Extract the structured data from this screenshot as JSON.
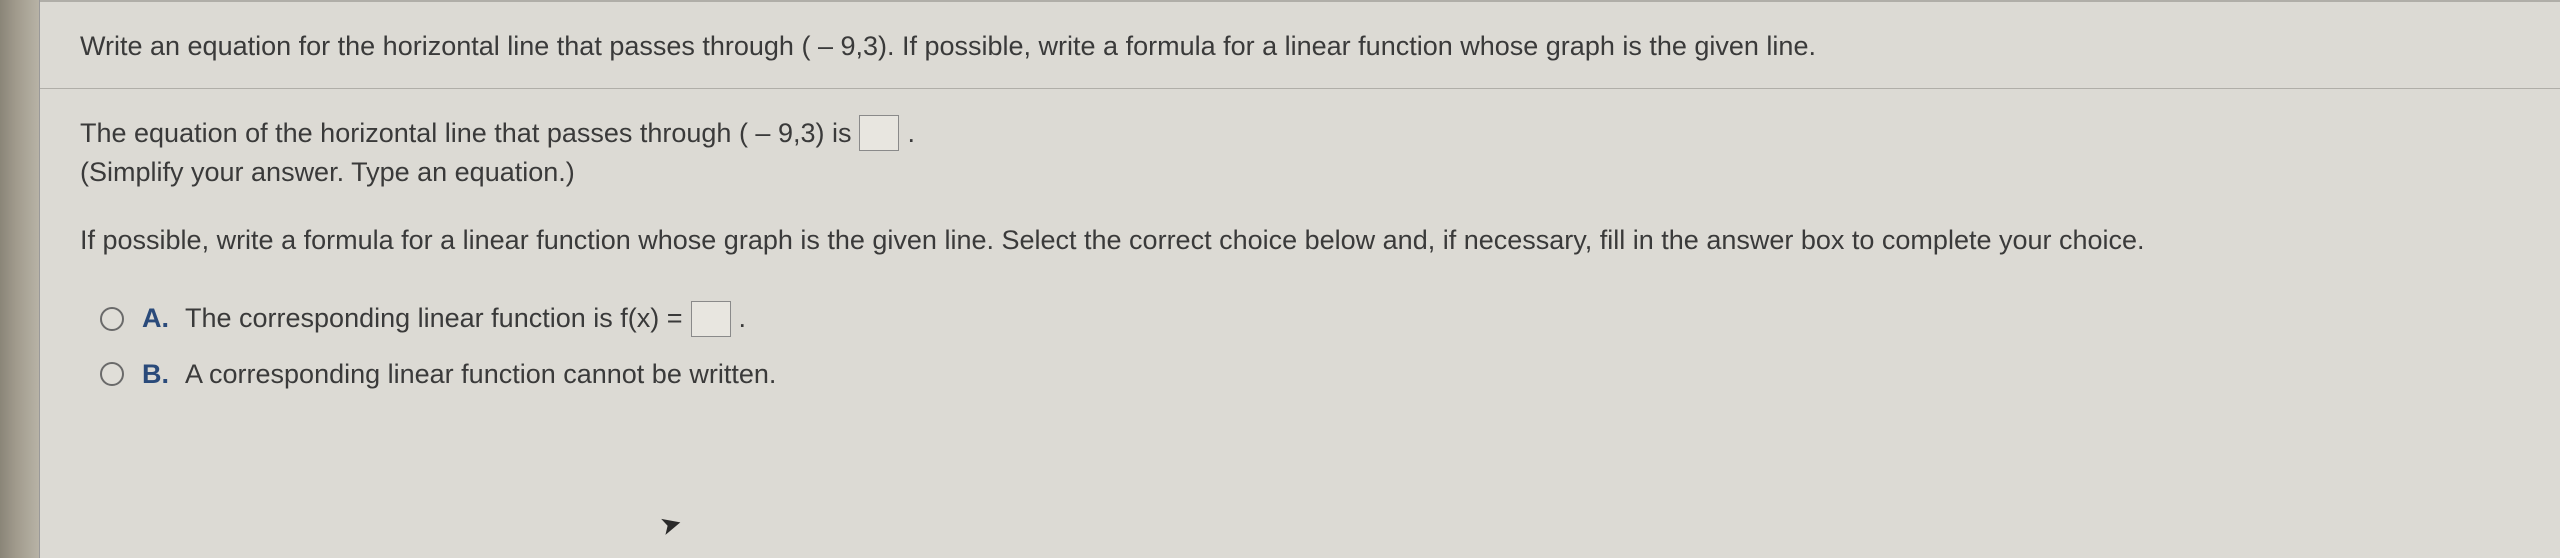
{
  "question": {
    "prompt": "Write an equation for the horizontal line that passes through ( – 9,3). If possible, write a formula for a linear function whose graph is the given line."
  },
  "part1": {
    "prefix": "The equation of the horizontal line that passes through ( – 9,3) is",
    "suffix": ".",
    "hint": "(Simplify your answer. Type an equation.)"
  },
  "part2": {
    "prompt": "If possible, write a formula for a linear function whose graph is the given line. Select the correct choice below and, if necessary, fill in the answer box to complete your choice."
  },
  "choices": {
    "a": {
      "letter": "A.",
      "prefix": "The corresponding linear function is f(x) =",
      "suffix": "."
    },
    "b": {
      "letter": "B.",
      "text": "A corresponding linear function cannot be written."
    }
  }
}
